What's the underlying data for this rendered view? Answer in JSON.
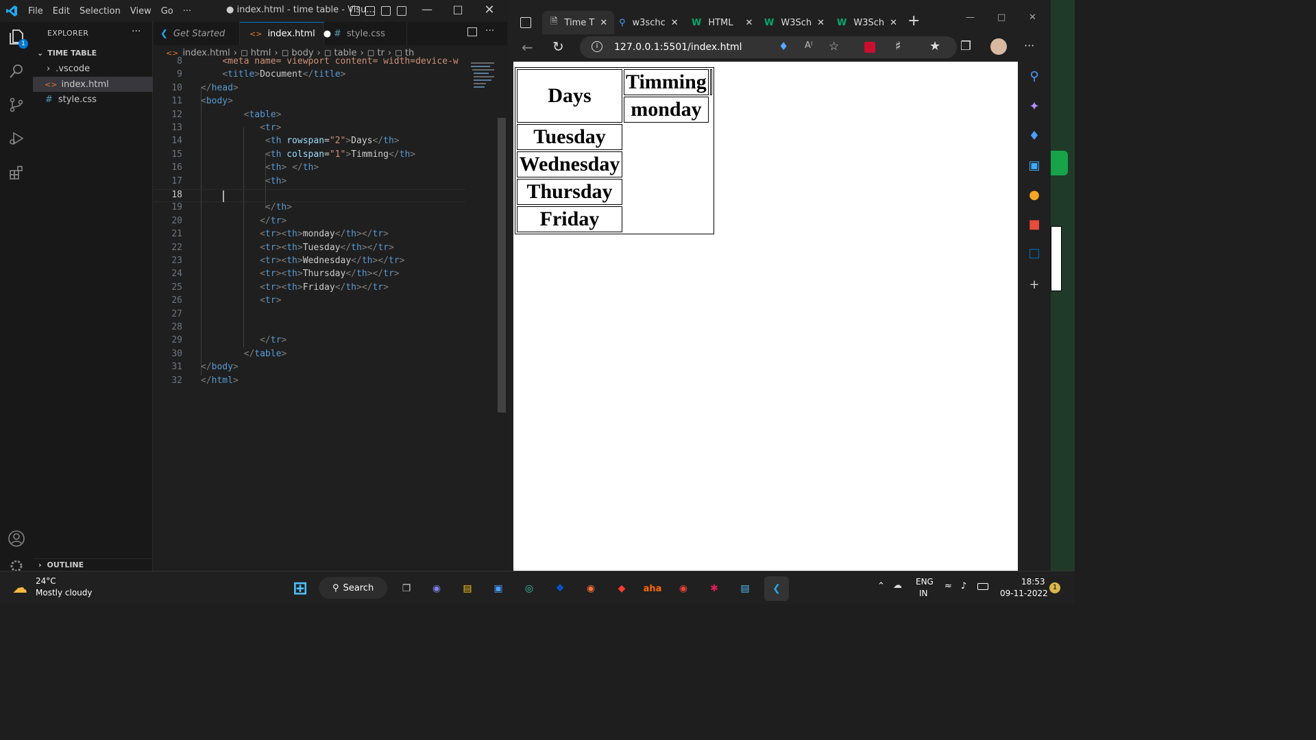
{
  "vscode": {
    "title_bar": {
      "menu": [
        "File",
        "Edit",
        "Selection",
        "View",
        "Go",
        "···"
      ],
      "window_title": "● index.html - time table - Visu..."
    },
    "explorer": {
      "header": "EXPLORER",
      "more": "···",
      "folder": "TIME TABLE",
      "items": [
        ".vscode",
        "index.html",
        "style.css"
      ],
      "outline": "OUTLINE",
      "badge": "1"
    },
    "tabs": [
      {
        "label": "Get Started"
      },
      {
        "label": "index.html",
        "dirty_marker": "●"
      },
      {
        "label": "style.css"
      }
    ],
    "breadcrumbs": [
      "index.html",
      "html",
      "body",
      "table",
      "tr",
      "th"
    ],
    "current_line": 18,
    "code_lines": [
      {
        "n": "8"
      },
      {
        "n": "9"
      },
      {
        "n": "10"
      },
      {
        "n": "11"
      },
      {
        "n": "12"
      },
      {
        "n": "13"
      },
      {
        "n": "14"
      },
      {
        "n": "15"
      },
      {
        "n": "16"
      },
      {
        "n": "17"
      },
      {
        "n": "18"
      },
      {
        "n": "19"
      },
      {
        "n": "20"
      },
      {
        "n": "21"
      },
      {
        "n": "22"
      },
      {
        "n": "23"
      },
      {
        "n": "24"
      },
      {
        "n": "25"
      },
      {
        "n": "26"
      },
      {
        "n": "27"
      },
      {
        "n": "28"
      },
      {
        "n": "29"
      },
      {
        "n": "30"
      },
      {
        "n": "31"
      },
      {
        "n": "32"
      }
    ],
    "code_text": {
      "l8a": "<meta name= viewport content= width=device-w",
      "l9_title": "Document",
      "l14_attr": "rowspan",
      "l14_val": "\"2\"",
      "l14_text": "Days",
      "l15_attr": "colspan",
      "l15_val": "\"1\"",
      "l15_text": "Timming",
      "l21_text": "monday",
      "l22_text": "Tuesday",
      "l23_text": "Wednesday",
      "l24_text": "Thursday",
      "l25_text": "Friday"
    }
  },
  "browser": {
    "tabs": [
      "Time T",
      "w3schc",
      "HTML",
      "W3Sch",
      "W3Sch"
    ],
    "url": "127.0.0.1:5501/index.html",
    "page_table": {
      "header_left": "Days",
      "header_right": "Timming",
      "right_cell": "monday",
      "rows": [
        "Tuesday",
        "Wednesday",
        "Thursday",
        "Friday"
      ]
    }
  },
  "taskbar": {
    "weather_temp": "24°C",
    "weather_desc": "Mostly cloudy",
    "search_label": "Search",
    "lang_1": "ENG",
    "lang_2": "IN",
    "time": "18:53",
    "date": "09-11-2022",
    "notif_badge": "1"
  },
  "colors": {
    "accent": "#0078d4",
    "vscode_bg": "#1f1f1f",
    "tag_blue": "#569cd6",
    "attr": "#9cdcfe",
    "string": "#ce9178"
  }
}
